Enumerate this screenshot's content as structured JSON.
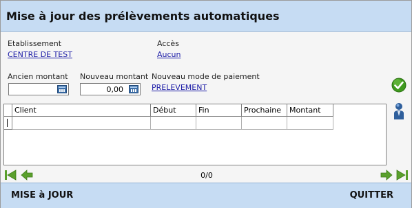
{
  "window": {
    "title": "Mise à jour des prélèvements automatiques"
  },
  "info": {
    "etablissement_label": "Etablissement",
    "etablissement_value": "CENTRE DE TEST",
    "acces_label": "Accès",
    "acces_value": "Aucun"
  },
  "form": {
    "ancien_label": "Ancien montant",
    "ancien_value": "",
    "nouveau_label": "Nouveau montant",
    "nouveau_value": "0,00",
    "mode_label": "Nouveau mode de paiement",
    "mode_value": "PRELEVEMENT"
  },
  "table": {
    "columns": [
      "Client",
      "Début",
      "Fin",
      "Prochaine",
      "Montant"
    ],
    "rows": []
  },
  "pager": {
    "text": "0/0"
  },
  "footer": {
    "update_label": "MISE à JOUR",
    "quit_label": "QUITTER"
  },
  "colors": {
    "bar": "#c6dcf3",
    "link": "#1a1aa6",
    "arrow_green": "#5aa02c",
    "check_green": "#3f9a1e"
  },
  "icons": {
    "validate": "check-circle-icon",
    "user": "user-icon",
    "first": "first-page-icon",
    "prev": "previous-page-icon",
    "next": "next-page-icon",
    "last": "last-page-icon",
    "calendar": "calendar-icon"
  }
}
